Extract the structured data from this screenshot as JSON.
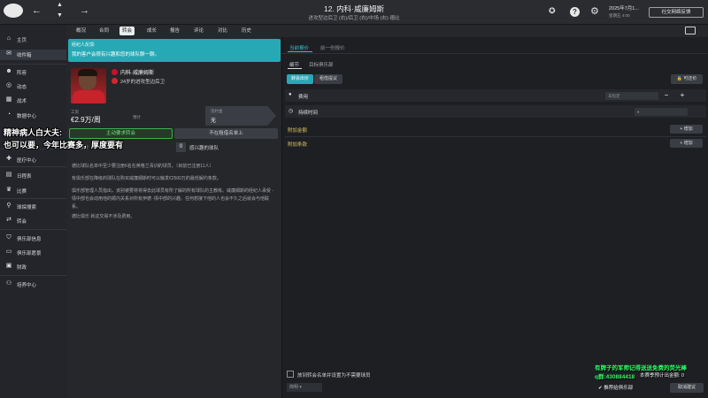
{
  "header": {
    "title": "12. 内科·威廉姆斯",
    "subtitle": "进攻型边后卫 (右)/后卫 (右)/中场 (右)·德比",
    "date": "2025年7月1...",
    "date_sub": "星期五 4:00",
    "social_button": "社交网络反馈"
  },
  "sidebar": {
    "items": [
      {
        "label": "主页",
        "icon": "home-icon"
      },
      {
        "label": "收件箱",
        "icon": "inbox-icon"
      },
      {
        "label": "阵容",
        "icon": "squad-icon"
      },
      {
        "label": "动态",
        "icon": "dynamics-icon"
      },
      {
        "label": "战术",
        "icon": "tactics-icon"
      },
      {
        "label": "数据中心",
        "icon": "data-icon"
      },
      {
        "label": "医疗中心",
        "icon": "medical-icon"
      },
      {
        "label": "日程表",
        "icon": "calendar-icon"
      },
      {
        "label": "比赛",
        "icon": "trophy-icon"
      },
      {
        "label": "球探搜索",
        "icon": "scouting-icon"
      },
      {
        "label": "转会",
        "icon": "transfer-icon"
      },
      {
        "label": "俱乐部信息",
        "icon": "club-info-icon"
      },
      {
        "label": "俱乐部愿景",
        "icon": "vision-icon"
      },
      {
        "label": "财政",
        "icon": "finance-icon"
      },
      {
        "label": "培养中心",
        "icon": "development-icon"
      }
    ]
  },
  "tabs": [
    "概况",
    "合同",
    "转会",
    "成长",
    "报告",
    "评论",
    "对比",
    "历史"
  ],
  "left": {
    "banner_label": "经纪人反馈:",
    "banner_text": "我的客户会很有兴趣和您的球队聊一聊。",
    "player_name": "内科·威廉姆斯",
    "player_desc": "24岁的进攻型边后卫",
    "wage_label": "工资",
    "wage": "€2.9万/周",
    "wage_unit": "预计",
    "clause_label": "违约金",
    "clause_value": "无",
    "offer_button": "主动要求转会",
    "list_button": "不在租借名单上",
    "mini_label": "租出报价",
    "interested_count": "0",
    "interested_label": "感兴趣的球队",
    "notes": [
      "德比球队名单中至少要注册6名在英格兰青训的球员。（目前已注册11人）",
      "有俱乐部在降级的球队在购买威廉姆斯时可以触发€2500万的最低解约条款。",
      "俱乐部管理人员指出，该别被要将将得去此球员有所了解的所有球队的主教练。威廉姆斯的经纪人承受 -情中部也会动用他的顺内关系对所有伊德 -情中部的兴趣。任何想接下他的人也会不久之后就会与他联系。",
      "德比俱乐 就这交易不涉及费用。"
    ]
  },
  "overlay": {
    "line1": "精神病人白大夫:",
    "line2": "也可以要，今年比赛多，厚度要有"
  },
  "right": {
    "tab_current": "当前报价",
    "tab_other": "前一份报价",
    "sub_details": "细节",
    "sub_target": "目标俱乐部",
    "pill_transfer": "转会出价",
    "pill_loan": "租借提议",
    "counter_button": "可还价",
    "fee_label": "费用",
    "fee_select": "未指定",
    "duration_label": "持续时间",
    "add_fee_label": "附加金额",
    "add_clause_label": "附加条款",
    "add_button": "增加",
    "checkbox_label": "放到转会名单并设置为不需要球员",
    "notes_select": "简明",
    "recommend_label": "推荐给俱乐部",
    "cancel_button": "取消建议"
  },
  "stream": {
    "line1": "有牌子的军师记得送送免费的荧光棒",
    "line2": "q群:430884418",
    "line3": "本赛季预计出金额: 0"
  },
  "colors": {
    "accent": "#2aa6b6",
    "offer_green": "#3fb04a",
    "stream_green": "#2dff6a",
    "banner": "#27a9b5"
  }
}
